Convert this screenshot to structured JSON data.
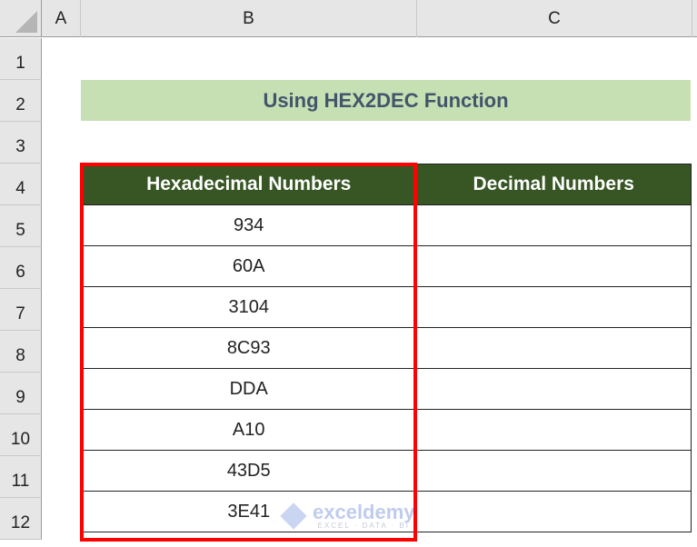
{
  "spreadsheet": {
    "columns": [
      "A",
      "B",
      "C"
    ],
    "rows": [
      "1",
      "2",
      "3",
      "4",
      "5",
      "6",
      "7",
      "8",
      "9",
      "10",
      "11",
      "12"
    ],
    "title": "Using HEX2DEC Function",
    "table": {
      "headers": [
        "Hexadecimal Numbers",
        "Decimal Numbers"
      ],
      "hex_values": [
        "934",
        "60A",
        "3104",
        "8C93",
        "DDA",
        "A10",
        "43D5",
        "3E41"
      ],
      "decimal_values": [
        "",
        "",
        "",
        "",
        "",
        "",
        "",
        ""
      ]
    },
    "highlight_color": "#ff0000",
    "header_fill": "#375623",
    "title_fill": "#c6e0b4"
  },
  "watermark": {
    "name": "exceldemy",
    "tagline": "EXCEL · DATA · BI"
  }
}
